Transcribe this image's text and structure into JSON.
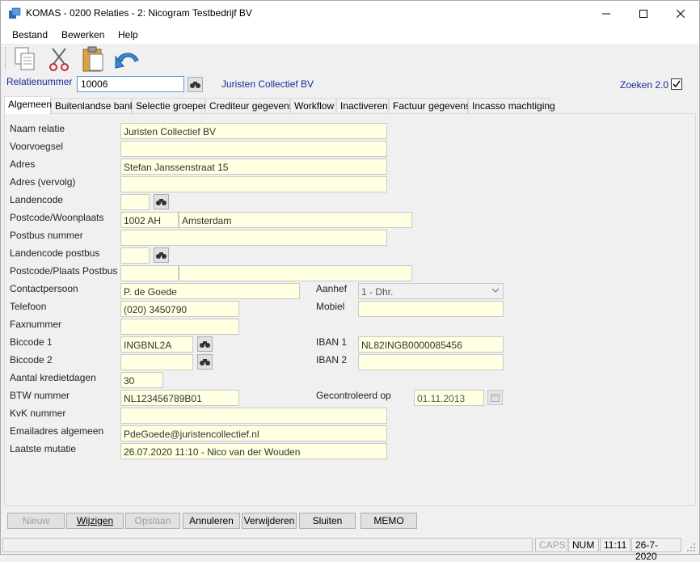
{
  "window": {
    "title": "KOMAS - 0200 Relaties - 2: Nicogram Testbedrijf BV"
  },
  "menu": [
    {
      "label": "Bestand"
    },
    {
      "label": "Bewerken"
    },
    {
      "label": "Help"
    }
  ],
  "toolbar": {
    "icons": [
      "copy-icon",
      "cut-icon",
      "paste-icon",
      "undo-icon"
    ]
  },
  "relatie": {
    "label": "Relatienummer",
    "value": "10006",
    "name": "Juristen Collectief BV",
    "zoeken_label": "Zoeken 2.0",
    "zoeken_checked": true
  },
  "tabs": [
    {
      "label": "Algemeen",
      "active": true
    },
    {
      "label": "Buitenlandse bank"
    },
    {
      "label": "Selectie groepen"
    },
    {
      "label": "Crediteur gegevens"
    },
    {
      "label": "Workflow"
    },
    {
      "label": "Inactiveren"
    },
    {
      "label": "Factuur gegevens"
    },
    {
      "label": "Incasso machtiging"
    }
  ],
  "form": {
    "naam_relatie": {
      "label": "Naam relatie",
      "value": "Juristen Collectief BV"
    },
    "voorvoegsel": {
      "label": "Voorvoegsel",
      "value": ""
    },
    "adres": {
      "label": "Adres",
      "value": "Stefan Janssenstraat 15"
    },
    "adres_vervolg": {
      "label": "Adres (vervolg)",
      "value": ""
    },
    "landencode": {
      "label": "Landencode",
      "value": ""
    },
    "postcode_woonplaats": {
      "label": "Postcode/Woonplaats",
      "postcode": "1002 AH",
      "plaats": "Amsterdam"
    },
    "postbus_nummer": {
      "label": "Postbus nummer",
      "value": ""
    },
    "landencode_postbus": {
      "label": "Landencode postbus",
      "value": ""
    },
    "postcode_plaats_postbus": {
      "label": "Postcode/Plaats Postbus",
      "postcode": "",
      "plaats": ""
    },
    "contactpersoon": {
      "label": "Contactpersoon",
      "value": "P. de Goede"
    },
    "aanhef": {
      "label": "Aanhef",
      "value": "1 - Dhr."
    },
    "telefoon": {
      "label": "Telefoon",
      "value": "(020) 3450790"
    },
    "mobiel": {
      "label": "Mobiel",
      "value": ""
    },
    "faxnummer": {
      "label": "Faxnummer",
      "value": ""
    },
    "biccode1": {
      "label": "Biccode 1",
      "value": "INGBNL2A"
    },
    "iban1": {
      "label": "IBAN 1",
      "value": "NL82INGB0000085456"
    },
    "biccode2": {
      "label": "Biccode 2",
      "value": ""
    },
    "iban2": {
      "label": "IBAN 2",
      "value": ""
    },
    "kredietdagen": {
      "label": "Aantal kredietdagen",
      "value": "30"
    },
    "btw": {
      "label": "BTW nummer",
      "value": "NL123456789B01"
    },
    "gecontroleerd": {
      "label": "Gecontroleerd op",
      "value": "01.11.2013"
    },
    "kvk": {
      "label": "KvK nummer",
      "value": ""
    },
    "email": {
      "label": "Emailadres algemeen",
      "value": "PdeGoede@juristencollectief.nl"
    },
    "laatste_mutatie": {
      "label": "Laatste mutatie",
      "value": "26.07.2020 11:10 - Nico van der Wouden"
    }
  },
  "buttons": [
    {
      "label": "Nieuw",
      "enabled": false
    },
    {
      "label": "Wijzigen",
      "enabled": true
    },
    {
      "label": "Opslaan",
      "enabled": false
    },
    {
      "label": "Annuleren",
      "enabled": true
    },
    {
      "label": "Verwijderen",
      "enabled": true
    },
    {
      "label": "Sluiten",
      "enabled": true
    },
    {
      "label": "MEMO",
      "enabled": true
    }
  ],
  "status": {
    "caps": "CAPS",
    "num": "NUM",
    "time": "11:11",
    "date": "26-7-2020"
  }
}
